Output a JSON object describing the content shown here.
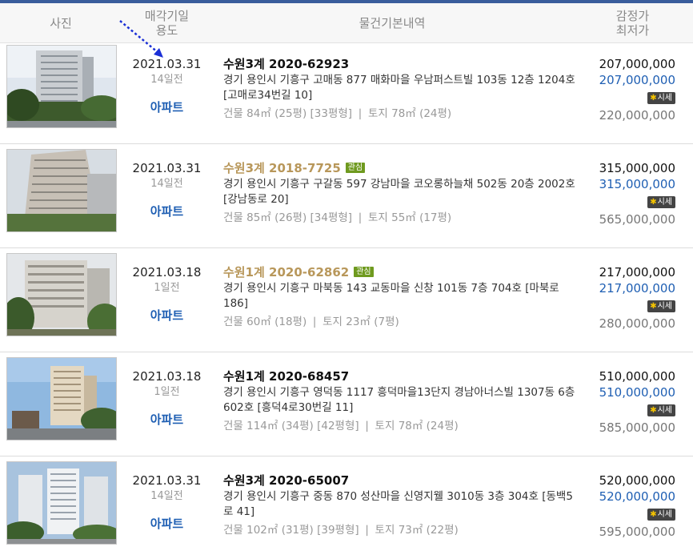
{
  "header": {
    "photo": "사진",
    "date_line1": "매각기일",
    "date_line2": "용도",
    "info": "물건기본내역",
    "price_line1": "감정가",
    "price_line2": "최저가"
  },
  "colors": {
    "accent": "#1f5fb3",
    "watched": "#b8975a",
    "watch_badge": "#6f9a1f",
    "top_bar": "#3a5d9c"
  },
  "items": [
    {
      "date": "2021.03.31",
      "ago": "14일전",
      "usage": "아파트",
      "case": "수원3계 2020-62923",
      "watched": false,
      "badge": "",
      "addr": "경기 용인시 기흥구 고매동 877 매화마을 우남퍼스트빌 103동 12층 1204호 [고매로34번길 10]",
      "area": "건물 84㎡ (25평) [33평형]  ❘  토지 78㎡ (24평)",
      "appraise": "207,000,000",
      "min": "207,000,000",
      "sise": "시세",
      "market": "220,000,000"
    },
    {
      "date": "2021.03.31",
      "ago": "14일전",
      "usage": "아파트",
      "case": "수원3계 2018-7725",
      "watched": true,
      "badge": "관심",
      "addr": "경기 용인시 기흥구 구갈동 597 강남마을 코오롱하늘채 502동 20층 2002호 [강남동로 20]",
      "area": "건물 85㎡ (26평) [34평형]  ❘  토지 55㎡ (17평)",
      "appraise": "315,000,000",
      "min": "315,000,000",
      "sise": "시세",
      "market": "565,000,000"
    },
    {
      "date": "2021.03.18",
      "ago": "1일전",
      "usage": "아파트",
      "case": "수원1계 2020-62862",
      "watched": true,
      "badge": "관심",
      "addr": "경기 용인시 기흥구 마북동 143 교동마을 신창 101동 7층 704호 [마북로 186]",
      "area": "건물 60㎡ (18평)  ❘  토지 23㎡ (7평)",
      "appraise": "217,000,000",
      "min": "217,000,000",
      "sise": "시세",
      "market": "280,000,000"
    },
    {
      "date": "2021.03.18",
      "ago": "1일전",
      "usage": "아파트",
      "case": "수원1계 2020-68457",
      "watched": false,
      "badge": "",
      "addr": "경기 용인시 기흥구 영덕동 1117 흥덕마을13단지 경남아너스빌 1307동 6층 602호 [흥덕4로30번길 11]",
      "area": "건물 114㎡ (34평) [42평형]  ❘  토지 78㎡ (24평)",
      "appraise": "510,000,000",
      "min": "510,000,000",
      "sise": "시세",
      "market": "585,000,000"
    },
    {
      "date": "2021.03.31",
      "ago": "14일전",
      "usage": "아파트",
      "case": "수원3계 2020-65007",
      "watched": false,
      "badge": "",
      "addr": "경기 용인시 기흥구 중동 870 성산마을 신영지웰 3010동 3층 304호 [동백5로 41]",
      "area": "건물 102㎡ (31평) [39평형]  ❘  토지 73㎡ (22평)",
      "appraise": "520,000,000",
      "min": "520,000,000",
      "sise": "시세",
      "market": "595,000,000"
    }
  ]
}
